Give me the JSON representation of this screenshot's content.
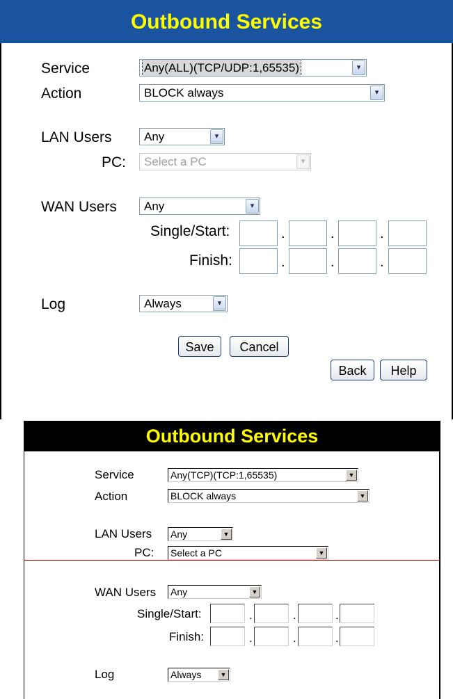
{
  "panel1": {
    "title": "Outbound Services",
    "service_label": "Service",
    "service_value": "Any(ALL)(TCP/UDP:1,65535)",
    "action_label": "Action",
    "action_value": "BLOCK always",
    "lan_users_label": "LAN Users",
    "lan_users_value": "Any",
    "pc_label": "PC:",
    "pc_value": "Select a PC",
    "wan_users_label": "WAN Users",
    "wan_users_value": "Any",
    "single_start_label": "Single/Start:",
    "finish_label": "Finish:",
    "ip_separator": ".",
    "log_label": "Log",
    "log_value": "Always",
    "save_label": "Save",
    "cancel_label": "Cancel",
    "back_label": "Back",
    "help_label": "Help",
    "arrow_glyph": "▾",
    "colors": {
      "header_bg": "#1a54a0",
      "title_text": "#ffff00"
    }
  },
  "panel2": {
    "title": "Outbound Services",
    "service_label": "Service",
    "service_value": "Any(TCP)(TCP:1,65535)",
    "action_label": "Action",
    "action_value": "BLOCK always",
    "lan_users_label": "LAN Users",
    "lan_users_value": "Any",
    "pc_label": "PC:",
    "pc_value": "Select a PC",
    "wan_users_label": "WAN Users",
    "wan_users_value": "Any",
    "single_start_label": "Single/Start:",
    "finish_label": "Finish:",
    "ip_separator": ".",
    "log_label": "Log",
    "log_value": "Always",
    "arrow_glyph": "▼",
    "colors": {
      "header_bg": "#000000",
      "title_text": "#ffff00",
      "divider": "#c00000"
    }
  }
}
